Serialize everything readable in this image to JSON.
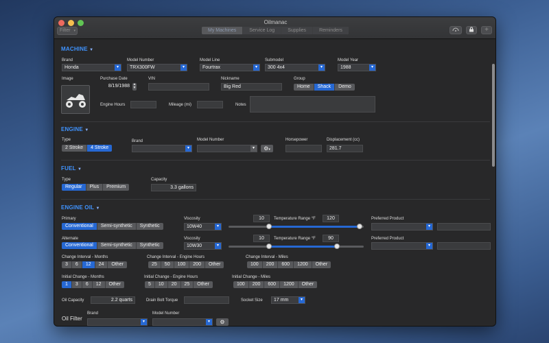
{
  "window": {
    "title": "Oilmanac"
  },
  "toolbar": {
    "filter_label": "Filter",
    "tabs": [
      "My Machines",
      "Service Log",
      "Supplies",
      "Reminders"
    ],
    "selected_tab": "My Machines",
    "add_label": "+"
  },
  "machine": {
    "header": "MACHINE",
    "brand_label": "Brand",
    "brand": "Honda",
    "model_number_label": "Model Number",
    "model_number": "TRX300FW",
    "model_line_label": "Model Line",
    "model_line": "Fourtrax",
    "submodel_label": "Submodel",
    "submodel": "300 4x4",
    "model_year_label": "Model Year",
    "model_year": "1988",
    "image_label": "Image",
    "purchase_date_label": "Purchase Date",
    "purchase_date": "8/19/1988",
    "vin_label": "VIN",
    "vin": "",
    "nickname_label": "Nickname",
    "nickname": "Big Red",
    "group_label": "Group",
    "groups": [
      "Home",
      "Shack",
      "Demo"
    ],
    "group_selected": "Shack",
    "engine_hours_label": "Engine Hours",
    "mileage_label": "Mileage (mi)",
    "notes_label": "Notes"
  },
  "engine": {
    "header": "ENGINE",
    "type_label": "Type",
    "types": [
      "2 Stroke",
      "4 Stroke"
    ],
    "type_selected": "4 Stroke",
    "brand_label": "Brand",
    "model_number_label": "Model Number",
    "horsepower_label": "Horsepower",
    "displacement_label": "Displacement (cc)",
    "displacement": "281.7"
  },
  "fuel": {
    "header": "FUEL",
    "type_label": "Type",
    "types": [
      "Regular",
      "Plus",
      "Premium"
    ],
    "type_selected": "Regular",
    "capacity_label": "Capacity",
    "capacity": "3.3 gallons"
  },
  "engine_oil": {
    "header": "ENGINE OIL",
    "primary": {
      "label": "Primary",
      "types": [
        "Conventional",
        "Semi-synthetic",
        "Synthetic"
      ],
      "type_selected": "Conventional",
      "viscosity_label": "Viscosity",
      "viscosity": "10W40",
      "temp_label": "Temperature Range °F",
      "temp_low": "10",
      "temp_high": "120",
      "temp_low_frac": 0.3,
      "temp_high_frac": 0.97,
      "preferred_label": "Preferred Product"
    },
    "alternate": {
      "label": "Alternate",
      "types": [
        "Conventional",
        "Semi-synthetic",
        "Synthetic"
      ],
      "type_selected": "Conventional",
      "viscosity_label": "Viscosity",
      "viscosity": "10W30",
      "temp_label": "Temperature Range °F",
      "temp_low": "10",
      "temp_high": "90",
      "temp_low_frac": 0.3,
      "temp_high_frac": 0.8,
      "preferred_label": "Preferred Product"
    },
    "change_months_label": "Change Interval - Months",
    "change_months": [
      "3",
      "6",
      "12",
      "24",
      "Other"
    ],
    "change_months_selected": "12",
    "change_hours_label": "Change Interval - Engine Hours",
    "change_hours": [
      "25",
      "50",
      "100",
      "200",
      "Other"
    ],
    "change_miles_label": "Change Interval - Miles",
    "change_miles": [
      "100",
      "200",
      "600",
      "1200",
      "Other"
    ],
    "initial_months_label": "Initial Change - Months",
    "initial_months": [
      "1",
      "3",
      "6",
      "12",
      "Other"
    ],
    "initial_months_selected": "1",
    "initial_hours_label": "Initial Change - Engine Hours",
    "initial_hours": [
      "5",
      "10",
      "20",
      "25",
      "Other"
    ],
    "initial_miles_label": "Initial Change - Miles",
    "initial_miles": [
      "100",
      "200",
      "600",
      "1200",
      "Other"
    ],
    "oil_capacity_label": "Oil Capacity",
    "oil_capacity": "2.2 quarts",
    "drain_bolt_label": "Drain Bolt Torque",
    "socket_size_label": "Socket Size",
    "socket_size": "17 mm"
  },
  "oil_filter": {
    "label": "Oil Filter",
    "brand_label": "Brand",
    "model_number_label": "Model Number"
  },
  "icons": {
    "wifi": "signal-icon",
    "lock": "lock-icon",
    "gear": "gear-icon",
    "atv": "atv-icon",
    "disclosure": "triangle-down-icon",
    "popup": "chevron-down-icon"
  },
  "colors": {
    "accent": "#2668d3",
    "header": "#3f93ff"
  }
}
